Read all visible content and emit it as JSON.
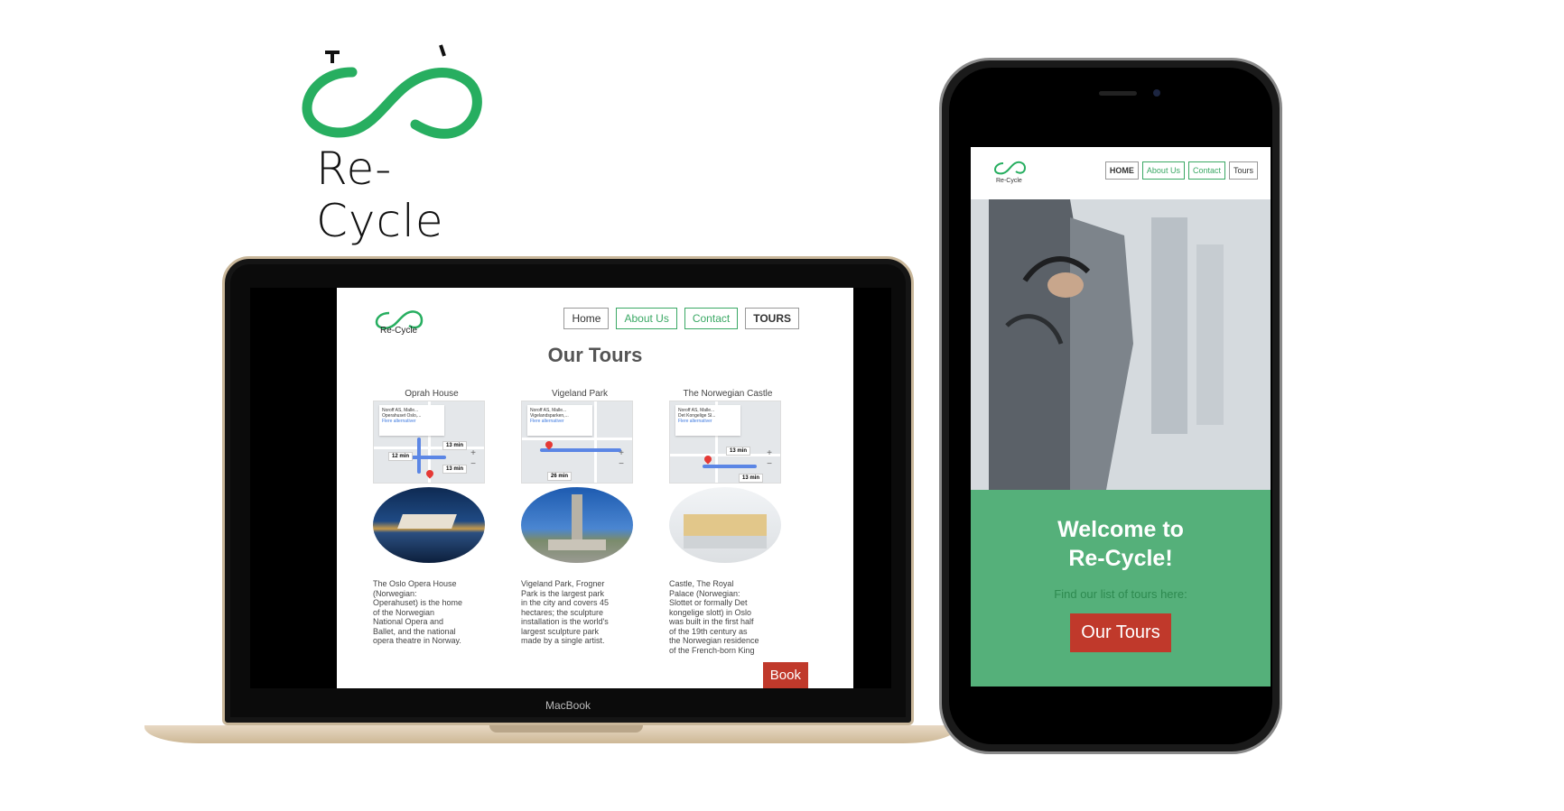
{
  "brand": {
    "name": "Re-Cycle",
    "accent": "#3aa864",
    "cta_color": "#c0392b"
  },
  "laptop": {
    "device_label": "MacBook",
    "logo_text": "Re-Cycle",
    "nav": [
      {
        "label": "Home"
      },
      {
        "label": "About Us"
      },
      {
        "label": "Contact"
      },
      {
        "label": "TOURS"
      }
    ],
    "title": "Our Tours",
    "tours": [
      {
        "name": "Oprah House",
        "map": {
          "from": "Noroff AS, Malle...",
          "to": "Operahuset Oslo,...",
          "alt": "Flere alternativer",
          "time1": "12 min",
          "time2": "13 min",
          "time3": "13 min"
        },
        "description": "The Oslo Opera House (Norwegian: Operahuset) is the home of the Norwegian National Opera and Ballet, and the national opera theatre in Norway."
      },
      {
        "name": "Vigeland Park",
        "map": {
          "from": "Noroff AS, Malle...",
          "to": "Vigelandsparken,...",
          "alt": "Flere alternativer",
          "time1": "26 min"
        },
        "description": "Vigeland Park, Frogner Park is the largest park in the city and covers 45 hectares; the sculpture installation is the world's largest sculpture park made by a single artist."
      },
      {
        "name": "The Norwegian Castle",
        "map": {
          "from": "Noroff AS, Malle...",
          "to": "Det Kongelige Sl...",
          "alt": "Flere alternativer",
          "time1": "13 min",
          "time2": "13 min"
        },
        "description": "Castle, The Royal Palace (Norwegian: Slottet or formally Det kongelige slott) in Oslo was built in the first half of the 19th century as the Norwegian residence of the French-born King"
      }
    ],
    "book_label": "Book"
  },
  "phone": {
    "logo_text": "Re-Cycle",
    "nav": [
      {
        "label": "HOME"
      },
      {
        "label": "About Us"
      },
      {
        "label": "Contact"
      },
      {
        "label": "Tours"
      }
    ],
    "welcome_line1": "Welcome to",
    "welcome_line2": "Re-Cycle!",
    "subtitle": "Find our list of tours here:",
    "cta_label": "Our Tours"
  }
}
